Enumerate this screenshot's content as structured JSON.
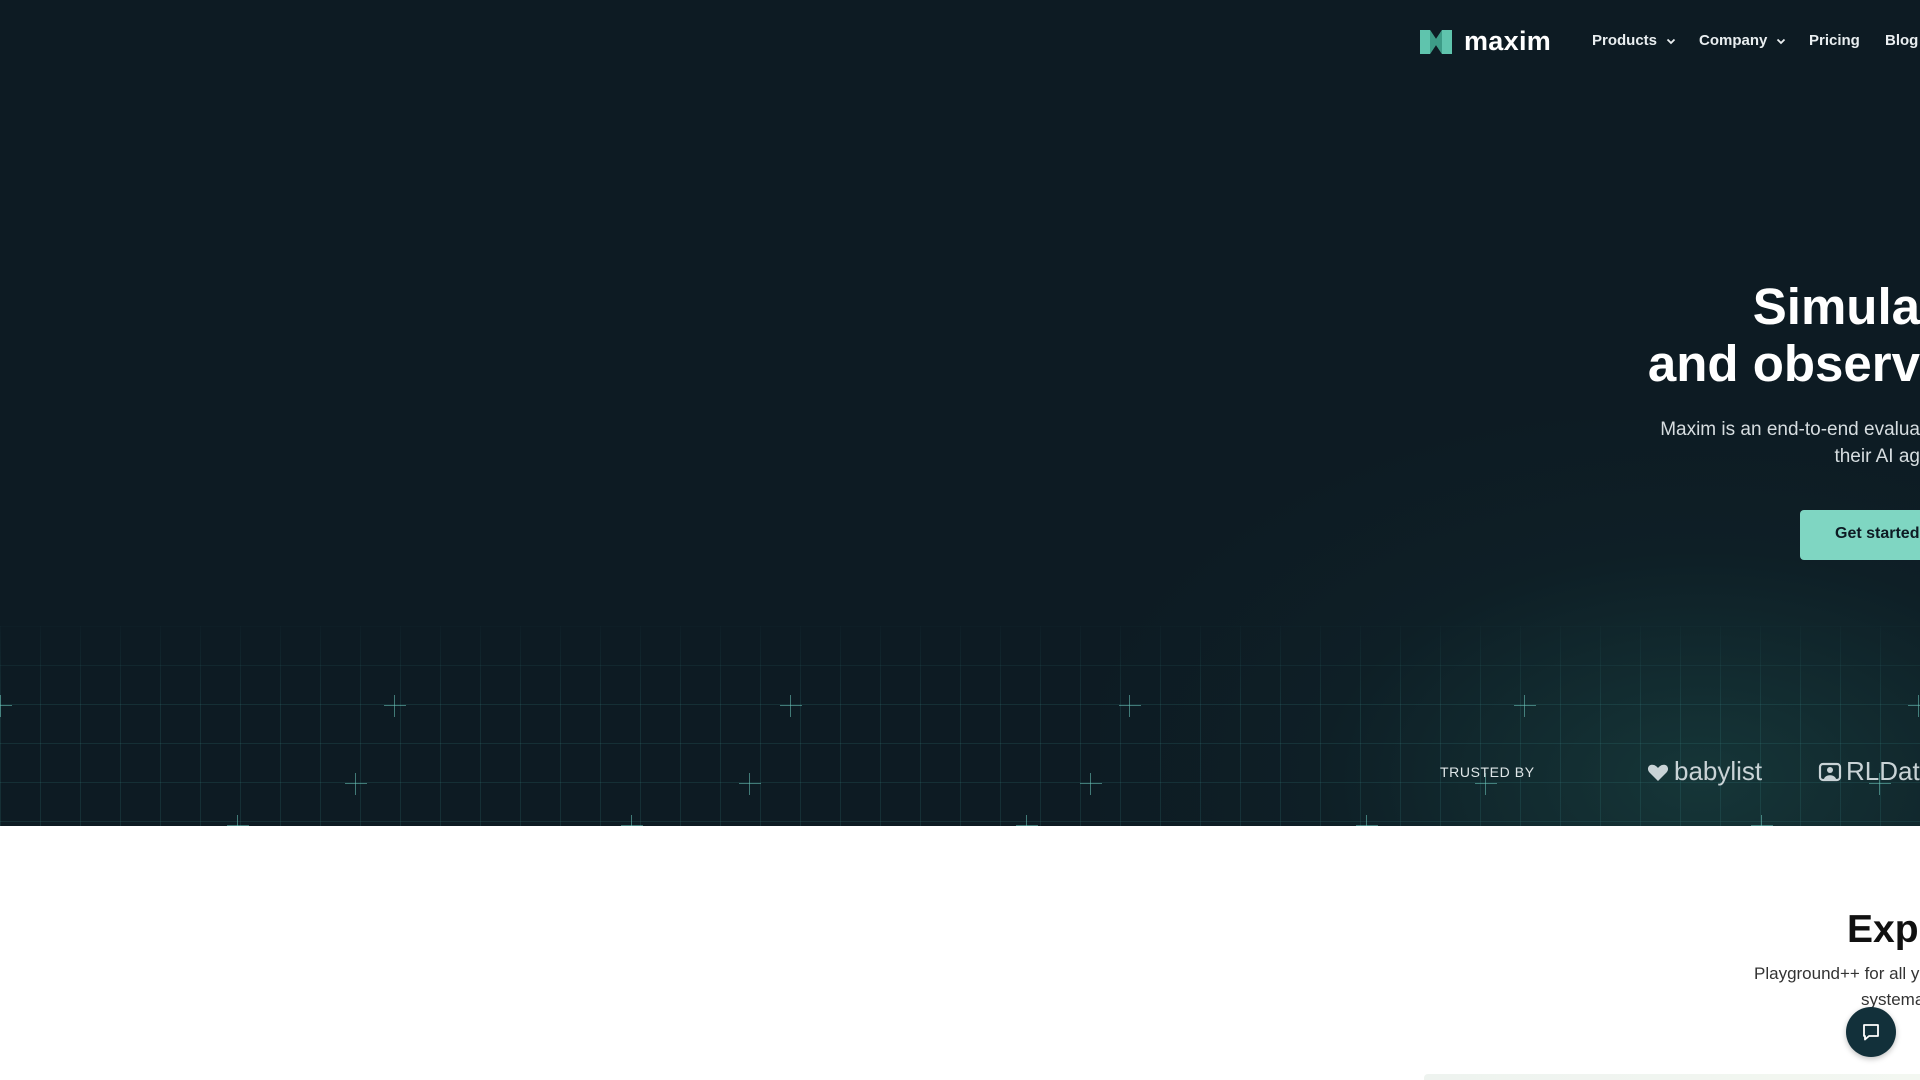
{
  "nav": {
    "logo_text": "maxim",
    "items": [
      {
        "label": "Products",
        "has_dropdown": true
      },
      {
        "label": "Company",
        "has_dropdown": true
      },
      {
        "label": "Pricing",
        "has_dropdown": false
      },
      {
        "label": "Blog",
        "has_dropdown": false
      }
    ]
  },
  "hero": {
    "headline_line1": "Simula",
    "headline_line2": "and observ",
    "subtitle_line1": "Maxim is an end-to-end evalua",
    "subtitle_line2": "their AI ag",
    "cta_label": "Get started"
  },
  "trusted": {
    "label": "TRUSTED BY",
    "brands": [
      {
        "name": "babylist",
        "icon": "heart-icon"
      },
      {
        "name": "RLDat",
        "icon": "rldatix-icon"
      }
    ]
  },
  "section": {
    "title": "Expe",
    "subtitle_line1": "Playground++ for all y",
    "subtitle_line2": "systema"
  },
  "colors": {
    "hero_bg": "#0d1b23",
    "accent": "#7fd6c2",
    "chat_button": "#12303a"
  }
}
